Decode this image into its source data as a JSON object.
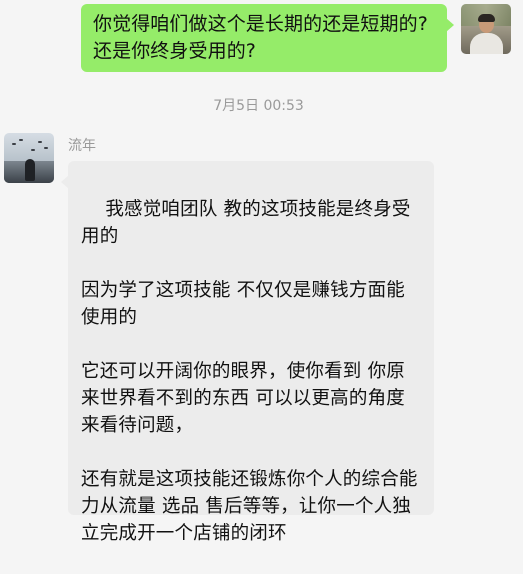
{
  "outgoing_message": {
    "text": "你觉得咱们做这个是长期的还是短期的?还是你终身受用的?"
  },
  "timestamp": "7月5日 00:53",
  "incoming_message": {
    "sender_name": "流年",
    "text": "我感觉咱团队 教的这项技能是终身受用的\n\n因为学了这项技能 不仅仅是赚钱方面能使用的\n\n它还可以开阔你的眼界，使你看到 你原来世界看不到的东西 可以以更高的角度来看待问题，\n\n还有就是这项技能还锻炼你个人的综合能力从流量 选品 售后等等，让你一个人独立完成开一个店铺的闭环"
  },
  "colors": {
    "background": "#f5f5f5",
    "outgoing_bubble": "#95ec69",
    "incoming_bubble": "#ececec",
    "meta_text": "#9a9a9a"
  },
  "icons": {
    "self_avatar": "user-avatar-photo",
    "other_avatar": "contact-avatar-photo"
  }
}
